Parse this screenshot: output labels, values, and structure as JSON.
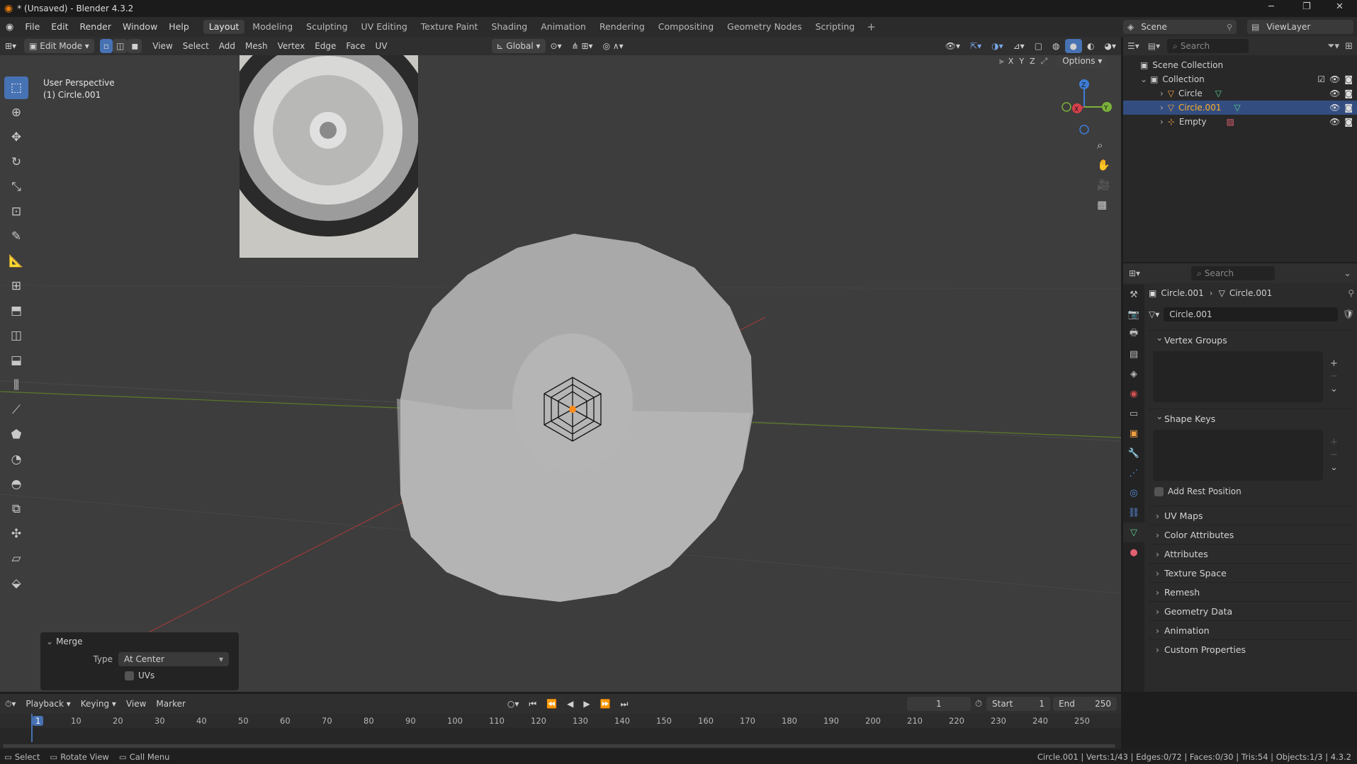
{
  "app": {
    "title": "* (Unsaved) - Blender 4.3.2"
  },
  "menu": [
    "File",
    "Edit",
    "Render",
    "Window",
    "Help"
  ],
  "workspaces": [
    "Layout",
    "Modeling",
    "Sculpting",
    "UV Editing",
    "Texture Paint",
    "Shading",
    "Animation",
    "Rendering",
    "Compositing",
    "Geometry Nodes",
    "Scripting"
  ],
  "active_workspace": "Layout",
  "scene": {
    "name": "Scene",
    "view_layer": "ViewLayer"
  },
  "viewport_header": {
    "mode": "Edit Mode",
    "menus": [
      "View",
      "Select",
      "Add",
      "Mesh",
      "Vertex",
      "Edge",
      "Face",
      "UV"
    ],
    "transform_orientation": "Global",
    "options": "Options",
    "axes": [
      "X",
      "Y",
      "Z"
    ]
  },
  "viewport": {
    "perspective": "User Perspective",
    "object": "(1) Circle.001",
    "gizmo": {
      "x": "X",
      "y": "Y",
      "z": "Z"
    }
  },
  "merge_panel": {
    "title": "Merge",
    "type_label": "Type",
    "type_value": "At Center",
    "uvs_label": "UVs"
  },
  "outliner": {
    "search_placeholder": "Search",
    "root": "Scene Collection",
    "collection": "Collection",
    "items": [
      {
        "name": "Circle",
        "selected": false
      },
      {
        "name": "Circle.001",
        "selected": true
      },
      {
        "name": "Empty",
        "selected": false
      }
    ]
  },
  "properties": {
    "search_placeholder": "Search",
    "breadcrumb_object": "Circle.001",
    "breadcrumb_mesh": "Circle.001",
    "mesh_name": "Circle.001",
    "panels_open": [
      "Vertex Groups",
      "Shape Keys"
    ],
    "add_rest_position": "Add Rest Position",
    "panels_closed": [
      "UV Maps",
      "Color Attributes",
      "Attributes",
      "Texture Space",
      "Remesh",
      "Geometry Data",
      "Animation",
      "Custom Properties"
    ]
  },
  "timeline": {
    "menus": [
      "Playback",
      "Keying",
      "View",
      "Marker"
    ],
    "current_frame": "1",
    "start_label": "Start",
    "start": "1",
    "end_label": "End",
    "end": "250",
    "ticks": [
      "1",
      "10",
      "20",
      "30",
      "40",
      "50",
      "60",
      "70",
      "80",
      "90",
      "100",
      "110",
      "120",
      "130",
      "140",
      "150",
      "160",
      "170",
      "180",
      "190",
      "200",
      "210",
      "220",
      "230",
      "240",
      "250"
    ]
  },
  "status": {
    "select": "Select",
    "rotate": "Rotate View",
    "call_menu": "Call Menu",
    "stats": "Circle.001 | Verts:1/43 | Edges:0/72 | Faces:0/30 | Tris:54 | Objects:1/3 | 4.3.2"
  },
  "colors": {
    "accent": "#4772b3",
    "selected_row": "#334d80",
    "highlight_text": "#ffaf29"
  }
}
